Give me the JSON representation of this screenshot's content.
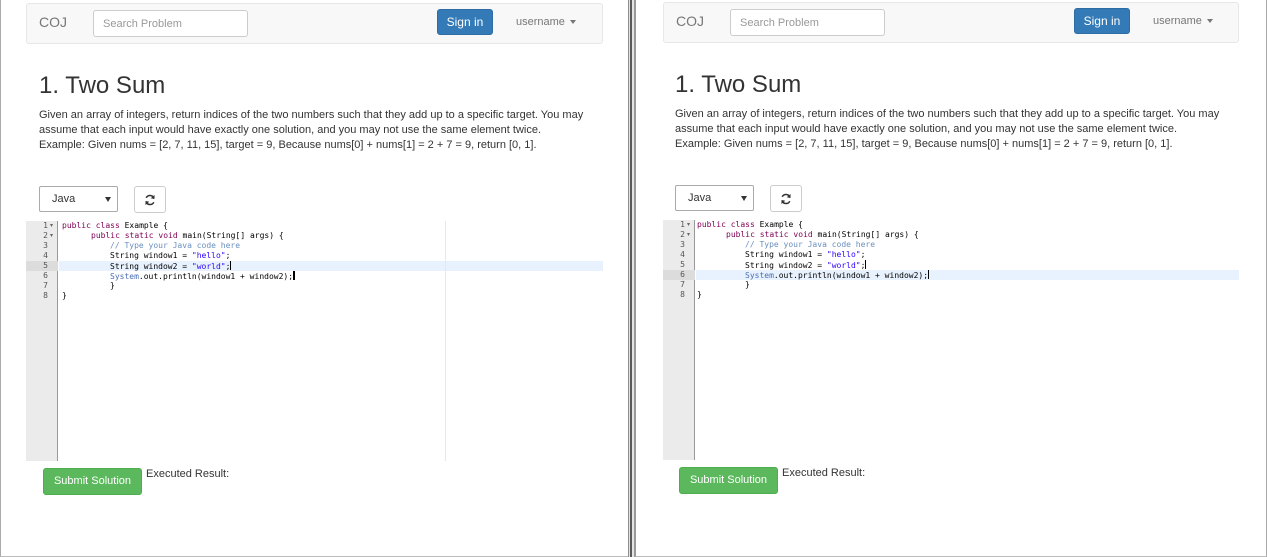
{
  "left": {
    "nav": {
      "brand": "COJ",
      "search_placeholder": "Search Problem",
      "signin": "Sign in",
      "username": "username"
    },
    "problem": {
      "title": "1. Two Sum",
      "description": "Given an array of integers, return indices of the two numbers such that they add up to a specific target. You may assume that each input would have exactly one solution, and you may not use the same element twice. Example: Given nums = [2, 7, 11, 15], target = 9, Because nums[0] + nums[1] = 2 + 7 = 9, return [0, 1]."
    },
    "language": "Java",
    "editor": {
      "line_numbers": [
        "1",
        "2",
        "3",
        "4",
        "5",
        "6",
        "7",
        "8"
      ],
      "active_line": 5,
      "l1_kw": "public class",
      "l1_rest": " Example {",
      "l2_kw": "public static void",
      "l2_rest": " main(String[] args) {",
      "l3_comment": "// Type your Java code here",
      "l4_pre": "String window1 = ",
      "l4_str": "\"hello\"",
      "l4_end": ";",
      "l5_pre": "String window2 = ",
      "l5_str": "\"world\"",
      "l5_end": ";",
      "l6_sys": "System",
      "l6_rest": ".out.println(window1 + window2);",
      "l7": "}",
      "l8": "}"
    },
    "submit": "Submit Solution",
    "result_label": "Executed Result:"
  },
  "right": {
    "nav": {
      "brand": "COJ",
      "search_placeholder": "Search Problem",
      "signin": "Sign in",
      "username": "username"
    },
    "problem": {
      "title": "1. Two Sum",
      "description": "Given an array of integers, return indices of the two numbers such that they add up to a specific target. You may assume that each input would have exactly one solution, and you may not use the same element twice. Example: Given nums = [2, 7, 11, 15], target = 9, Because nums[0] + nums[1] = 2 + 7 = 9, return [0, 1]."
    },
    "language": "Java",
    "editor": {
      "line_numbers": [
        "1",
        "2",
        "3",
        "4",
        "5",
        "6",
        "7",
        "8"
      ],
      "active_line": 6,
      "l1_kw": "public class",
      "l1_rest": " Example {",
      "l2_kw": "public static void",
      "l2_rest": " main(String[] args) {",
      "l3_comment": "// Type your Java code here",
      "l4_pre": "String window1 = ",
      "l4_str": "\"hello\"",
      "l4_end": ";",
      "l5_pre": "String window2 = ",
      "l5_str": "\"world\"",
      "l5_end": ";",
      "l6_sys": "System",
      "l6_rest": ".out.println(window1 + window2);",
      "l7": "}",
      "l8": "}"
    },
    "submit": "Submit Solution",
    "result_label": "Executed Result:"
  }
}
